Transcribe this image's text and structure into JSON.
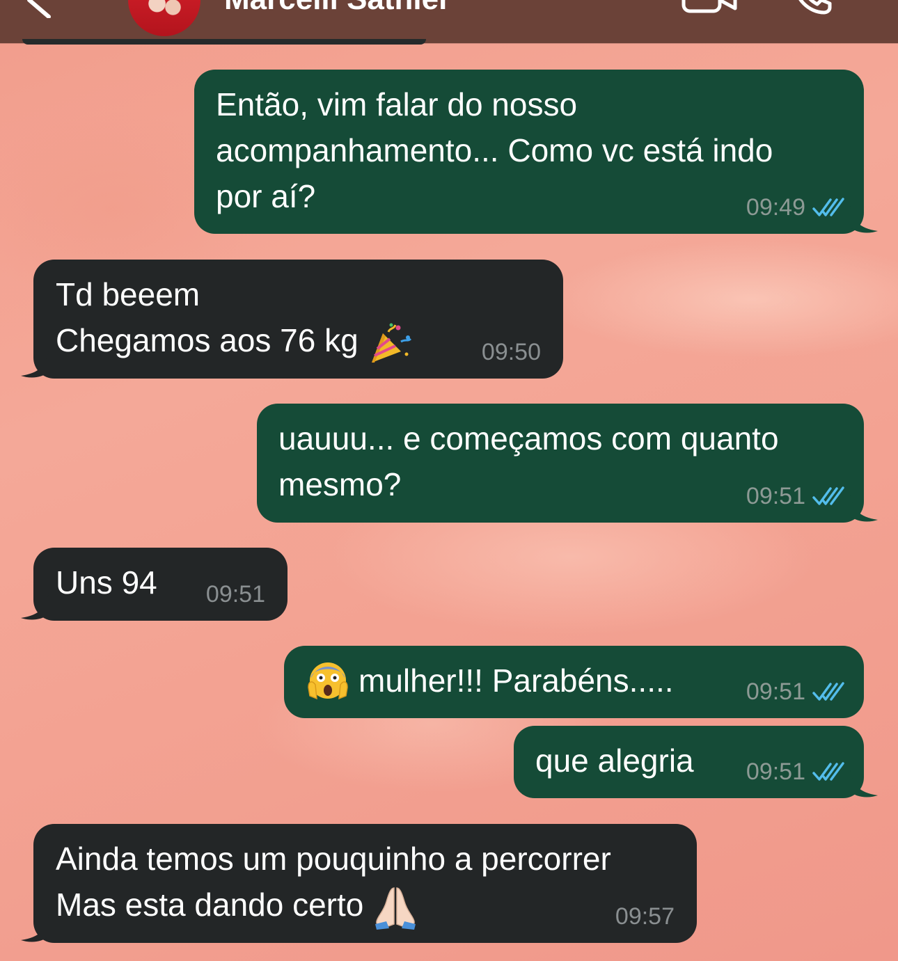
{
  "chat": {
    "contact_name": "Marcelli Sathler"
  },
  "messages": [
    {
      "direction": "out",
      "text": "Então, vim falar do nosso\nacompanhamento... Como vc está indo\npor aí?",
      "time": "09:49",
      "status": "read"
    },
    {
      "direction": "in",
      "line1": "Td beeem",
      "line2": "Chegamos aos 76 kg",
      "emoji": "party-popper",
      "time": "09:50"
    },
    {
      "direction": "out",
      "text": "uauuu... e começamos com quanto\nmesmo?",
      "time": "09:51",
      "status": "read"
    },
    {
      "direction": "in",
      "text": "Uns 94",
      "time": "09:51"
    },
    {
      "direction": "out",
      "emoji": "face-screaming-in-fear",
      "text": "mulher!!! Parabéns.....",
      "time": "09:51",
      "status": "read"
    },
    {
      "direction": "out",
      "text": "que alegria",
      "time": "09:51",
      "status": "read"
    },
    {
      "direction": "in",
      "line1": "Ainda temos um pouquinho a percorrer",
      "line2": "Mas esta dando certo",
      "emoji": "folded-hands",
      "time": "09:57"
    }
  ],
  "colors": {
    "outgoing_bubble": "#154b37",
    "incoming_bubble": "#232627",
    "read_ticks": "#53bdeb",
    "header": "#6b4238",
    "wallpaper": "#f3a292"
  }
}
